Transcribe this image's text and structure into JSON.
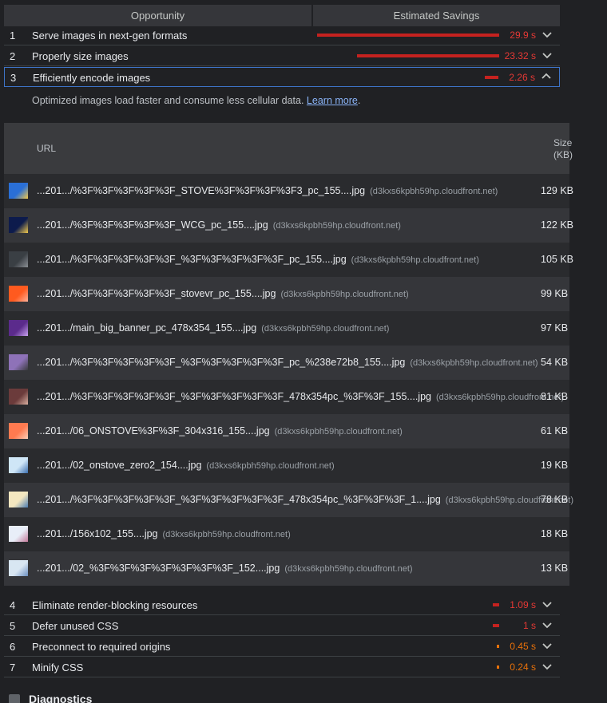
{
  "header": {
    "opportunity": "Opportunity",
    "savings": "Estimated Savings"
  },
  "opportunities_top": [
    {
      "num": "1",
      "title": "Serve images in next-gen formats",
      "savings": "29.9 s",
      "fraction": 1.0,
      "color": "#c5221f"
    },
    {
      "num": "2",
      "title": "Properly size images",
      "savings": "23.32 s",
      "fraction": 0.78,
      "color": "#c5221f"
    },
    {
      "num": "3",
      "title": "Efficiently encode images",
      "savings": "2.26 s",
      "fraction": 0.076,
      "color": "#c5221f",
      "expanded": true
    }
  ],
  "description": {
    "text": "Optimized images load faster and consume less cellular data. ",
    "link": "Learn more",
    "period": "."
  },
  "table": {
    "col_url": "URL",
    "col_size": "Size\n(KB)",
    "rows": [
      {
        "url": "...201.../%3F%3F%3F%3F%3F_STOVE%3F%3F%3F%3F3_pc_155....jpg",
        "host": "(d3kxs6kpbh59hp.cloudfront.net)",
        "size": "129 KB",
        "thumb": [
          "#2a6fd6",
          "#f2c94c"
        ]
      },
      {
        "url": "...201.../%3F%3F%3F%3F%3F_WCG_pc_155....jpg",
        "host": "(d3kxs6kpbh59hp.cloudfront.net)",
        "size": "122 KB",
        "thumb": [
          "#0d1b4c",
          "#f2c94c"
        ]
      },
      {
        "url": "...201.../%3F%3F%3F%3F%3F_%3F%3F%3F%3F%3F_pc_155....jpg",
        "host": "(d3kxs6kpbh59hp.cloudfront.net)",
        "size": "105 KB",
        "thumb": [
          "#3a3f44",
          "#8a8f94"
        ]
      },
      {
        "url": "...201.../%3F%3F%3F%3F%3F_stovevr_pc_155....jpg",
        "host": "(d3kxs6kpbh59hp.cloudfront.net)",
        "size": "99 KB",
        "thumb": [
          "#ff5a1f",
          "#ffb199"
        ]
      },
      {
        "url": "...201.../main_big_banner_pc_478x354_155....jpg",
        "host": "(d3kxs6kpbh59hp.cloudfront.net)",
        "size": "97 KB",
        "thumb": [
          "#5b2b8c",
          "#c9a3f0"
        ]
      },
      {
        "url": "...201.../%3F%3F%3F%3F%3F_%3F%3F%3F%3F%3F_pc_%238e72b8_155....jpg",
        "host": "(d3kxs6kpbh59hp.cloudfront.net)",
        "size": "54 KB",
        "thumb": [
          "#8e72b8",
          "#3a3b3e"
        ]
      },
      {
        "url": "...201.../%3F%3F%3F%3F%3F_%3F%3F%3F%3F%3F_478x354pc_%3F%3F_155....jpg",
        "host": "(d3kxs6kpbh59hp.cloudfront.net)",
        "size": "81 KB",
        "thumb": [
          "#6b3b3b",
          "#d9b0a0"
        ]
      },
      {
        "url": "...201.../06_ONSTOVE%3F%3F_304x316_155....jpg",
        "host": "(d3kxs6kpbh59hp.cloudfront.net)",
        "size": "61 KB",
        "thumb": [
          "#ff7a50",
          "#ffd0b8"
        ]
      },
      {
        "url": "...201.../02_onstove_zero2_154....jpg",
        "host": "(d3kxs6kpbh59hp.cloudfront.net)",
        "size": "19 KB",
        "thumb": [
          "#cfe6f7",
          "#3b6fb0"
        ]
      },
      {
        "url": "...201.../%3F%3F%3F%3F%3F_%3F%3F%3F%3F%3F_478x354pc_%3F%3F%3F_1....jpg",
        "host": "(d3kxs6kpbh59hp.cloudfront.net)",
        "size": "78 KB",
        "thumb": [
          "#f4e7c0",
          "#4a7bb0"
        ]
      },
      {
        "url": "...201.../156x102_155....jpg",
        "host": "(d3kxs6kpbh59hp.cloudfront.net)",
        "size": "18 KB",
        "thumb": [
          "#e8eef8",
          "#c47a9a"
        ]
      },
      {
        "url": "...201.../02_%3F%3F%3F%3F%3F%3F%3F_152....jpg",
        "host": "(d3kxs6kpbh59hp.cloudfront.net)",
        "size": "13 KB",
        "thumb": [
          "#d8e6f2",
          "#6b8fc0"
        ]
      }
    ]
  },
  "opportunities_bottom": [
    {
      "num": "4",
      "title": "Eliminate render-blocking resources",
      "savings": "1.09 s",
      "fraction": 0.036,
      "color": "#c5221f"
    },
    {
      "num": "5",
      "title": "Defer unused CSS",
      "savings": "1 s",
      "fraction": 0.033,
      "color": "#c5221f"
    },
    {
      "num": "6",
      "title": "Preconnect to required origins",
      "savings": "0.45 s",
      "fraction": 0.015,
      "color": "#e8710a"
    },
    {
      "num": "7",
      "title": "Minify CSS",
      "savings": "0.24 s",
      "fraction": 0.008,
      "color": "#e8710a"
    }
  ],
  "diagnostics": {
    "title": "Diagnostics"
  },
  "icons": {
    "chevron_down": "chevron-down-icon",
    "chevron_up": "chevron-up-icon"
  }
}
